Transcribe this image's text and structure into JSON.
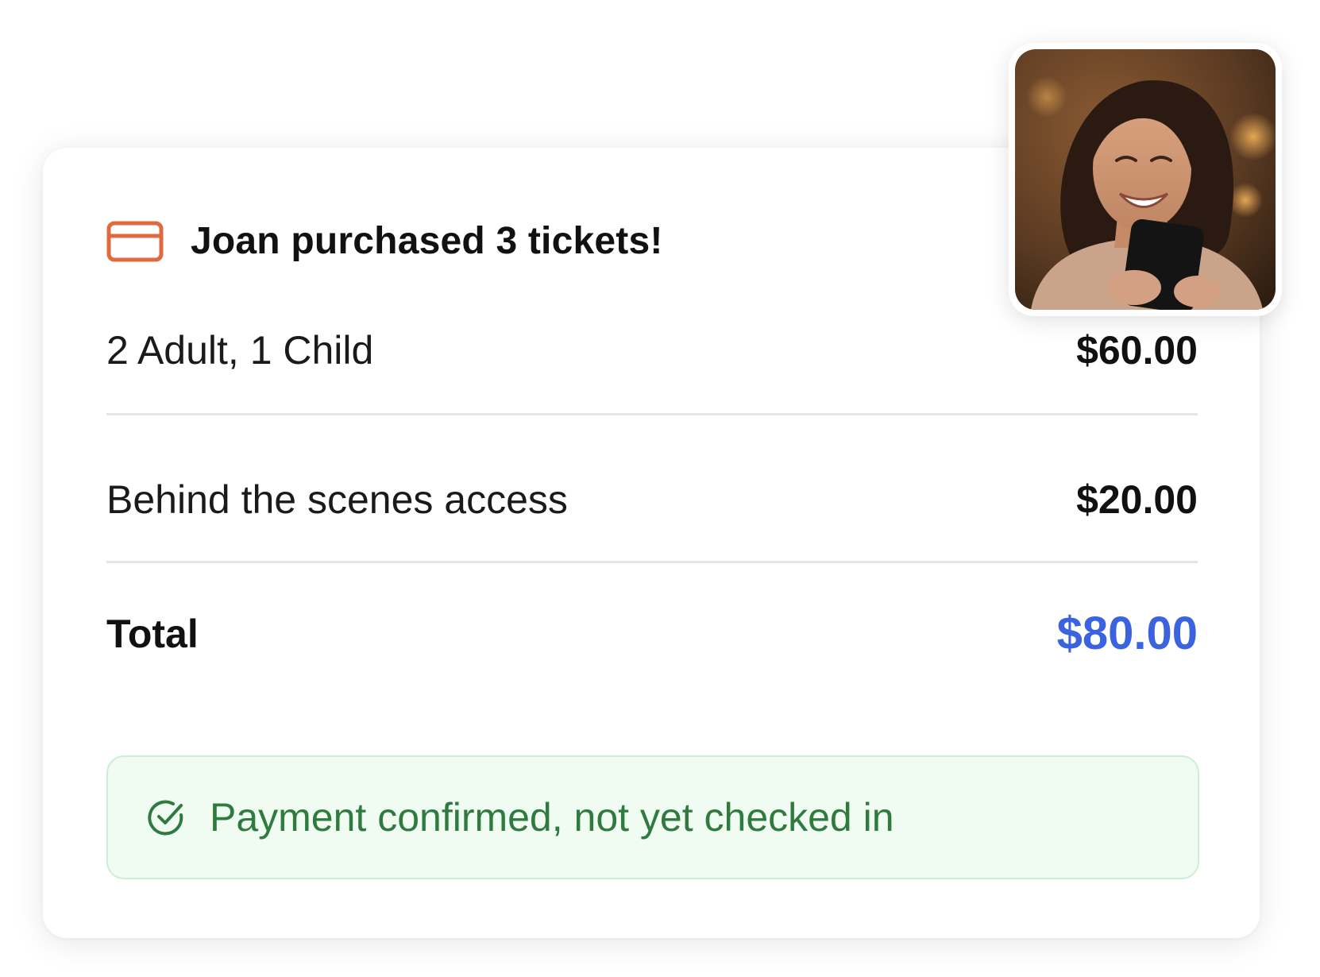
{
  "notification": {
    "title": "Joan purchased 3 tickets!",
    "icon": "credit-card-icon",
    "accent_color": "#e06a3f"
  },
  "line_items": [
    {
      "label": "2 Adult, 1 Child",
      "price": "$60.00"
    },
    {
      "label": "Behind the scenes access",
      "price": "$20.00"
    }
  ],
  "total": {
    "label": "Total",
    "price": "$80.00",
    "color": "#3b63e0"
  },
  "status": {
    "text": "Payment confirmed, not yet checked in",
    "icon": "check-circle-icon",
    "color": "#2f7a3e",
    "background": "#f0fbf2"
  },
  "avatar": {
    "icon": "user-photo"
  }
}
